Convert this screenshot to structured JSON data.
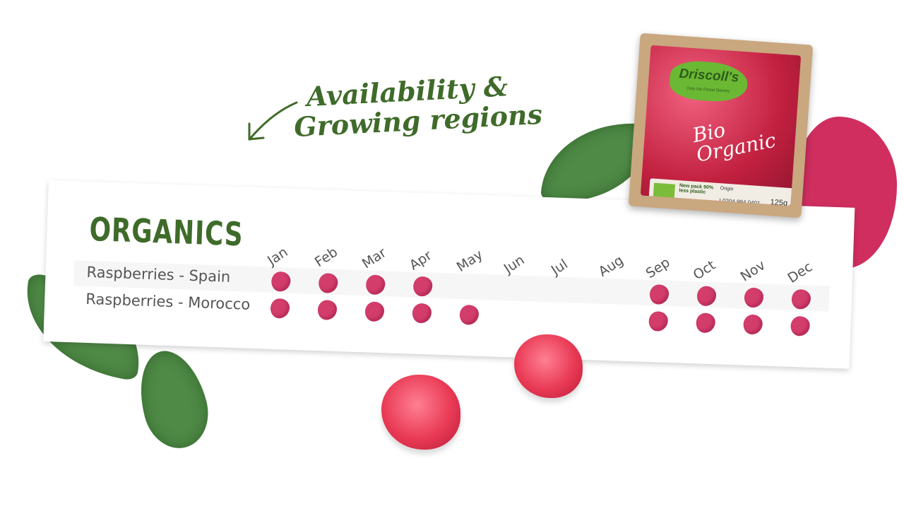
{
  "headline": {
    "line1": "Availability &",
    "line2": "Growing regions"
  },
  "package": {
    "brand": "Driscoll's",
    "tagline": "Only the Finest Berries",
    "bio": "Bio",
    "organic": "Organic",
    "label_claim": "New pack 90% less plastic",
    "label_origin": "Origin",
    "label_code": "L0204 994 0401",
    "weight": "125g"
  },
  "table": {
    "title": "ORGANICS",
    "months": [
      "Jan",
      "Feb",
      "Mar",
      "Apr",
      "May",
      "Jun",
      "Jul",
      "Aug",
      "Sep",
      "Oct",
      "Nov",
      "Dec"
    ],
    "rows": [
      {
        "label": "Raspberries - Spain",
        "available": [
          1,
          1,
          1,
          1,
          0,
          0,
          0,
          0,
          1,
          1,
          1,
          1
        ]
      },
      {
        "label": "Raspberries - Morocco",
        "available": [
          1,
          1,
          1,
          1,
          1,
          0,
          0,
          0,
          1,
          1,
          1,
          1
        ]
      }
    ]
  },
  "colors": {
    "green": "#3f6b2a",
    "berry": "#d33d6c"
  }
}
